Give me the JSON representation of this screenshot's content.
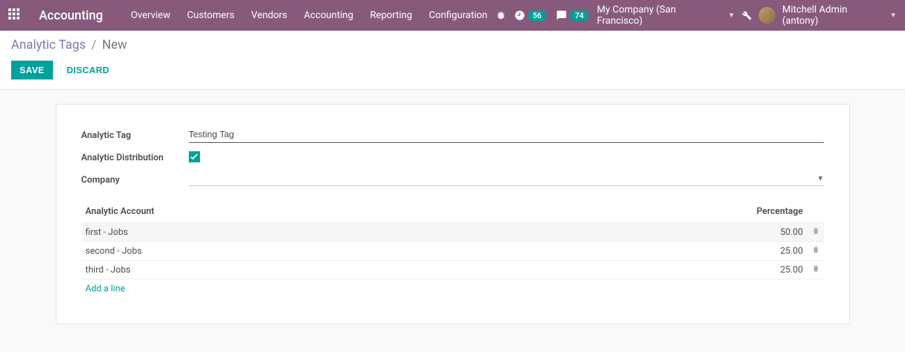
{
  "brand": "Accounting",
  "nav": {
    "items": [
      "Overview",
      "Customers",
      "Vendors",
      "Accounting",
      "Reporting",
      "Configuration"
    ],
    "activity_badge": "56",
    "discuss_badge": "74",
    "company": "My Company (San Francisco)",
    "user": "Mitchell Admin (antony)"
  },
  "breadcrumb": {
    "parent": "Analytic Tags",
    "current": "New"
  },
  "buttons": {
    "save": "SAVE",
    "discard": "DISCARD"
  },
  "form": {
    "label_tag": "Analytic Tag",
    "value_tag": "Testing Tag",
    "label_distribution": "Analytic Distribution",
    "value_distribution": true,
    "label_company": "Company",
    "value_company": ""
  },
  "table": {
    "col_account": "Analytic Account",
    "col_percentage": "Percentage",
    "rows": [
      {
        "account": "first - Jobs",
        "percentage": "50.00"
      },
      {
        "account": "second - Jobs",
        "percentage": "25.00"
      },
      {
        "account": "third - Jobs",
        "percentage": "25.00"
      }
    ],
    "add_line": "Add a line"
  }
}
